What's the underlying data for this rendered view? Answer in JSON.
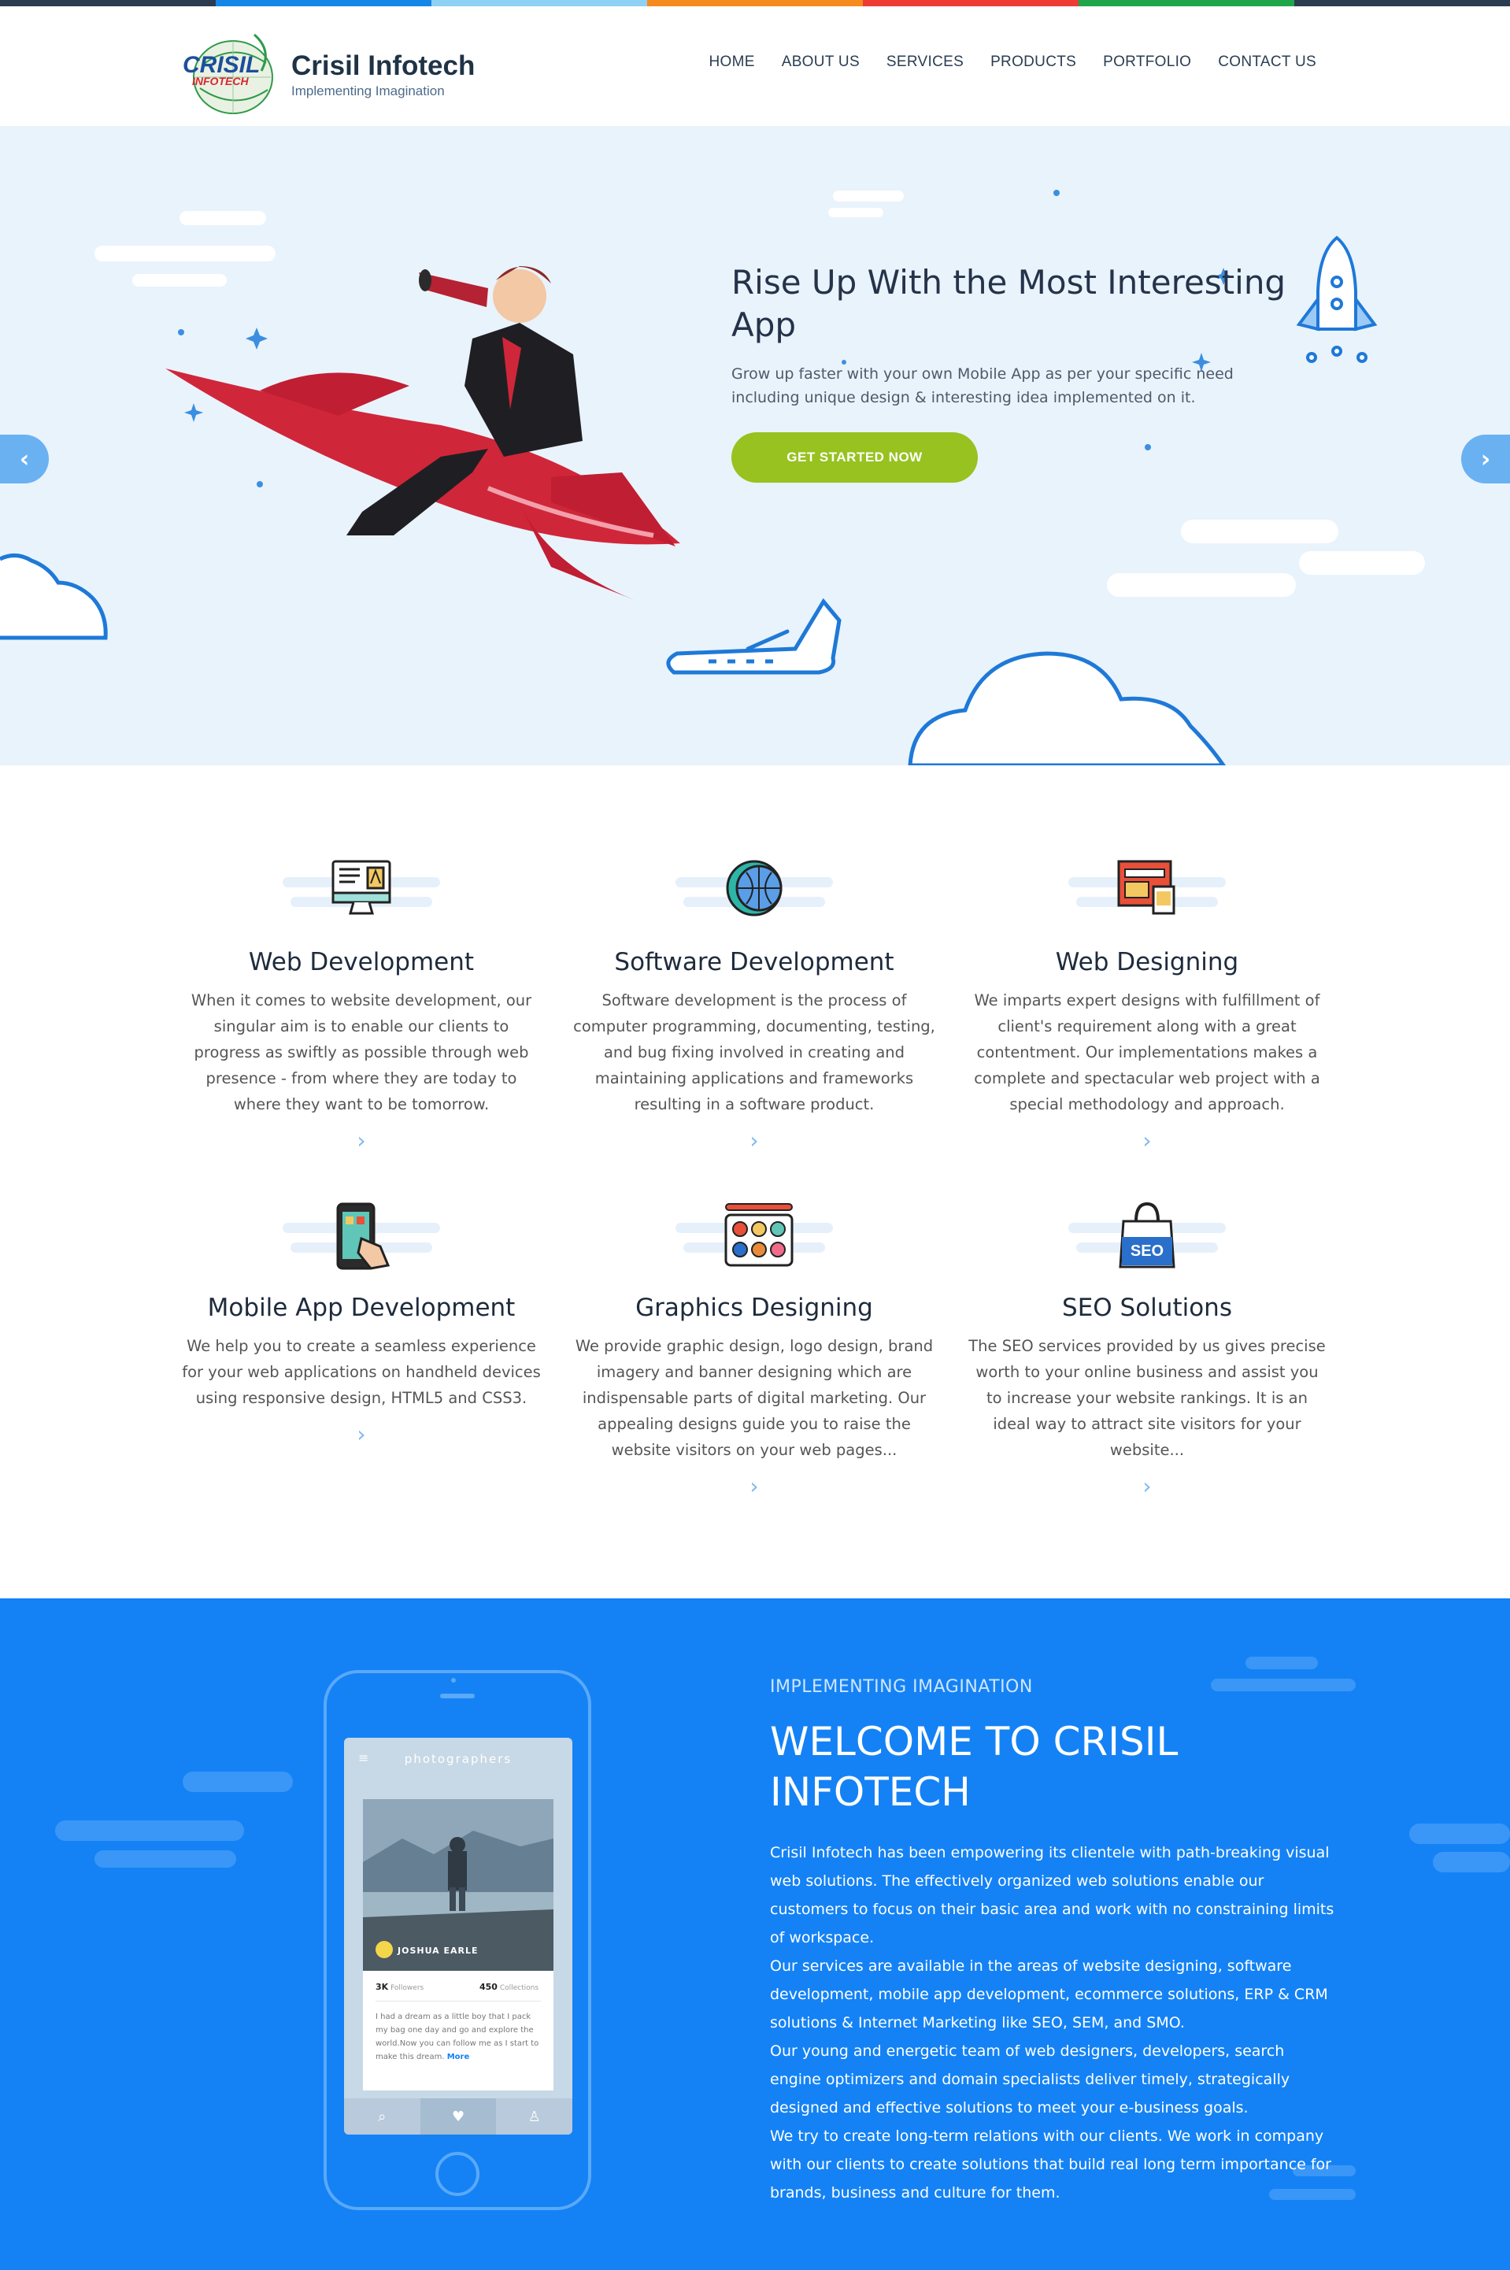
{
  "stripe_colors": [
    "#2b3c50",
    "#1486e8",
    "#8fd0f5",
    "#f58a1f",
    "#ee3b36",
    "#20a64a",
    "#2b3c50"
  ],
  "brand": {
    "name": "Crisil Infotech",
    "tagline": "Implementing Imagination",
    "mark_top": "CRISIL",
    "mark_bottom": "INFOTECH"
  },
  "nav": {
    "items": [
      "HOME",
      "ABOUT US",
      "SERVICES",
      "PRODUCTS",
      "PORTFOLIO",
      "CONTACT US"
    ]
  },
  "hero": {
    "title": "Rise Up With the Most Interesting App",
    "subtitle": "Grow up faster with your own Mobile App as per your specific need including unique design & interesting idea implemented on it.",
    "cta": "GET STARTED NOW",
    "prev_icon": "chevron-left-icon",
    "next_icon": "chevron-right-icon",
    "accent_color": "#97c21f"
  },
  "services": [
    {
      "title": "Web Development",
      "description": "When it comes to website development, our singular aim is to enable our clients to progress as swiftly as possible through web presence - from where they are today to where they want to be tomorrow.",
      "icon": "monitor-icon"
    },
    {
      "title": "Software Development",
      "description": "Software development is the process of computer programming, documenting, testing, and bug fixing involved in creating and maintaining applications and frameworks resulting in a software product.",
      "icon": "globe-gear-icon"
    },
    {
      "title": "Web Designing",
      "description": "We imparts expert designs with fulfillment of client's requirement along with a great contentment. Our implementations makes a complete and spectacular web project with a special methodology and approach.",
      "icon": "web-layout-icon"
    },
    {
      "title": "Mobile App Development",
      "description": "We help you to create a seamless experience for your web applications on handheld devices using responsive design, HTML5 and CSS3.",
      "icon": "mobile-touch-icon"
    },
    {
      "title": "Graphics Designing",
      "description": "We provide graphic design, logo design, brand imagery and banner designing which are indispensable parts of digital marketing. Our appealing designs guide you to raise the website visitors on your web pages...",
      "icon": "palette-icon"
    },
    {
      "title": "SEO Solutions",
      "description": "The SEO services provided by us gives precise worth to your online business and assist you to increase your website rankings. It is an ideal way to attract site visitors for your website...",
      "icon": "seo-bag-icon",
      "badge": "SEO"
    }
  ],
  "welcome": {
    "kicker": "IMPLEMENTING IMAGINATION",
    "title": "WELCOME TO CRISIL INFOTECH",
    "paragraphs": [
      "Crisil Infotech has been empowering its clientele with path-breaking visual web solutions. The effectively organized web solutions enable our customers to focus on their basic area and work with no constraining limits of workspace.",
      "Our services are available in the areas of website designing, software development, mobile app development, ecommerce solutions, ERP & CRM solutions & Internet Marketing like SEO, SEM, and SMO.",
      "Our young and energetic team of web designers, developers, search engine optimizers and domain specialists deliver timely, strategically designed and effective solutions to meet your e-business goals.",
      "We try to create long-term relations with our clients. We work in company with our clients to create solutions that build real long term importance for brands, business and culture for them."
    ],
    "background_color": "#1482f5",
    "phone": {
      "screen_title": "photographers",
      "profile_name": "JOSHUA EARLE",
      "followers_count": "3K",
      "followers_label": "Followers",
      "collections_count": "450",
      "collections_label": "Collections",
      "bio": "I had a dream as a little boy that I pack my bag one day and go and explore the world.Now you can follow me as I start to make this dream.",
      "more_link": "More",
      "tab_icons": [
        "search-icon",
        "heart-icon",
        "user-icon"
      ]
    }
  }
}
